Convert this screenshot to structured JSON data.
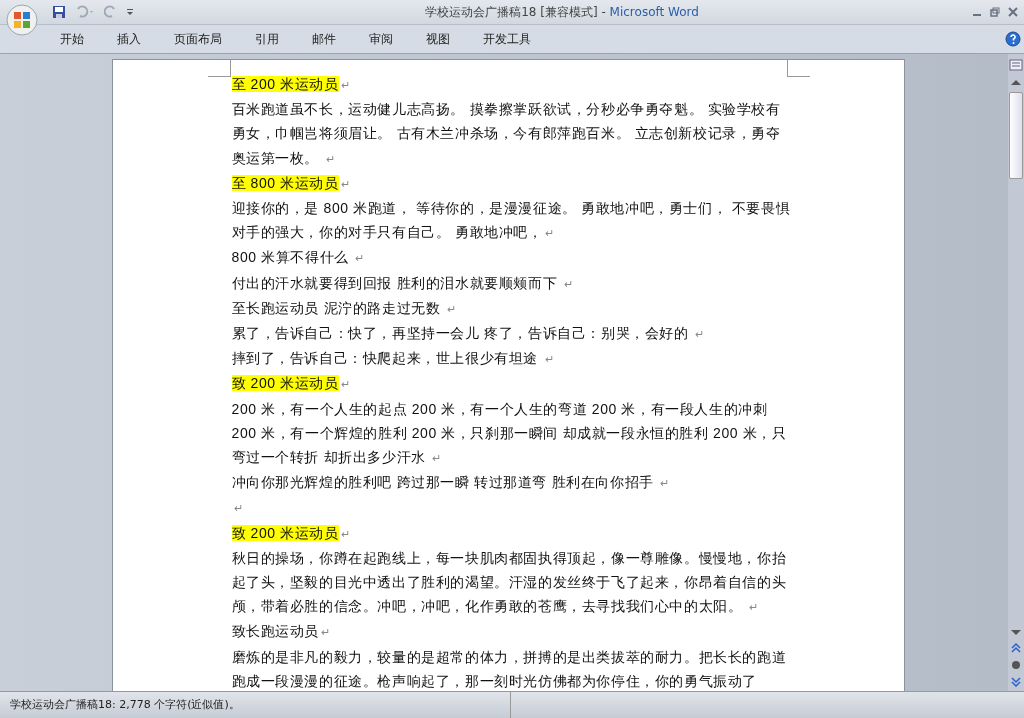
{
  "window": {
    "title": "学校运动会广播稿18 [兼容模式]",
    "separator": "-",
    "app_name": "Microsoft Word"
  },
  "tabs": [
    {
      "label": "开始",
      "selected": false
    },
    {
      "label": "插入",
      "selected": false
    },
    {
      "label": "页面布局",
      "selected": false
    },
    {
      "label": "引用",
      "selected": false
    },
    {
      "label": "邮件",
      "selected": false
    },
    {
      "label": "审阅",
      "selected": false
    },
    {
      "label": "视图",
      "selected": false
    },
    {
      "label": "开发工具",
      "selected": false
    }
  ],
  "document": {
    "paragraphs": [
      {
        "text": "至 200 米运动员",
        "highlight": true,
        "mark": "↵"
      },
      {
        "text": "百米跑道虽不长，运动健儿志高扬。  摸拳擦掌跃欲试，分秒必争勇夺魁。  实验学校有勇女，巾帼岂将须眉让。  古有木兰冲杀场，今有郎萍跑百米。  立志创新校记录，勇夺奥运第一枚。  ",
        "highlight": false,
        "mark": "↵"
      },
      {
        "text": "至 800 米运动员",
        "highlight": true,
        "mark": "↵"
      },
      {
        "text": "迎接你的，是 800 米跑道， 等待你的，是漫漫征途。 勇敢地冲吧，勇士们， 不要畏惧对手的强大，你的对手只有自己。 勇敢地冲吧，",
        "highlight": false,
        "mark": "↵"
      },
      {
        "text": "800 米算不得什么 ",
        "highlight": false,
        "mark": "↵"
      },
      {
        "text": "付出的汗水就要得到回报 胜利的泪水就要顺颊而下  ",
        "highlight": false,
        "mark": "↵"
      },
      {
        "text": "至长跑运动员  泥泞的路走过无数 ",
        "highlight": false,
        "mark": "↵"
      },
      {
        "text": "累了，告诉自己：快了，再坚持一会儿 疼了，告诉自己：别哭，会好的 ",
        "highlight": false,
        "mark": "↵"
      },
      {
        "text": "摔到了，告诉自己：快爬起来，世上很少有坦途   ",
        "highlight": false,
        "mark": "↵"
      },
      {
        "text": "致 200 米运动员",
        "highlight": true,
        "mark": "↵"
      },
      {
        "text": "200 米，有一个人生的起点 200 米，有一个人生的弯道  200 米，有一段人生的冲刺 200 米，有一个辉煌的胜利  200 米，只刹那一瞬间 却成就一段永恒的胜利  200 米，只弯过一个转折 却折出多少汗水 ",
        "highlight": false,
        "mark": "↵"
      },
      {
        "text": "冲向你那光辉煌的胜利吧 跨过那一瞬 转过那道弯 胜利在向你招手 ",
        "highlight": false,
        "mark": "↵"
      },
      {
        "mark": "↵"
      },
      {
        "text": "致 200 米运动员",
        "highlight": true,
        "mark": "↵"
      },
      {
        "text": "秋日的操场，你蹲在起跑线上，每一块肌肉都固执得顶起，像一尊雕像。慢慢地，你抬起了头，坚毅的目光中透出了胜利的渴望。汗湿的发丝终于飞了起来，你昂着自信的头颅，带着必胜的信念。冲吧，冲吧，化作勇敢的苍鹰，去寻找我们心中的太阳。 ",
        "highlight": false,
        "mark": "↵"
      },
      {
        "text": "致长跑运动员",
        "highlight": false,
        "mark": "↵"
      },
      {
        "text": "磨炼的是非凡的毅力，较量的是超常的体力，拼搏的是出类拔萃的耐力。把长长的跑道跑成一段漫漫的征途。枪声响起了，那一刻时光仿佛都为你停住，你的勇气振动了",
        "highlight": false
      }
    ]
  },
  "status_bar": {
    "word_count": "学校运动会广播稿18: 2,778 个字符(近似值)。"
  }
}
